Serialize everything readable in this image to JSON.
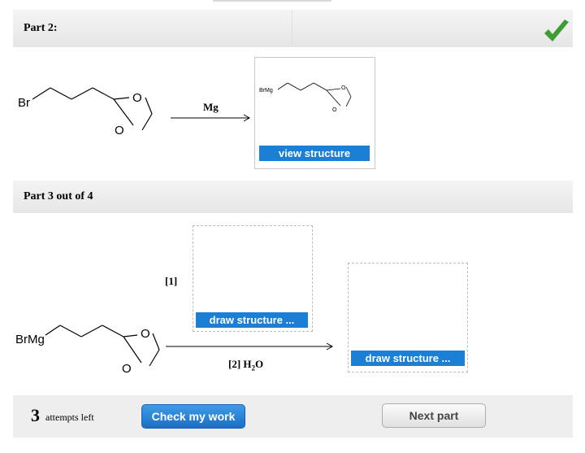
{
  "part2": {
    "title": "Part 2:",
    "status_icon": "checkmark-icon",
    "status_color": "#3f9c35"
  },
  "reaction1": {
    "reactant_atoms": {
      "br": "Br",
      "o_top": "O",
      "o_bottom": "O"
    },
    "reagent": "Mg",
    "product_atoms": {
      "brmg": "BrMg",
      "o_top": "O",
      "o_bottom": "O"
    },
    "view_button": "view structure"
  },
  "part3": {
    "title": "Part 3 out of 4"
  },
  "reaction2": {
    "reactant_atoms": {
      "brmg": "BrMg",
      "o_top": "O",
      "o_bottom": "O"
    },
    "step1_label": "[1]",
    "step2_label": "[2] H",
    "step2_sub": "2",
    "step2_tail": "O",
    "draw_button_1": "draw structure ...",
    "draw_button_2": "draw structure ..."
  },
  "footer": {
    "attempts_count": "3",
    "attempts_text": "attempts left",
    "check_button": "Check my work",
    "next_button": "Next part"
  },
  "colors": {
    "accent": "#1c7fd6",
    "band": "#eaeaea"
  }
}
